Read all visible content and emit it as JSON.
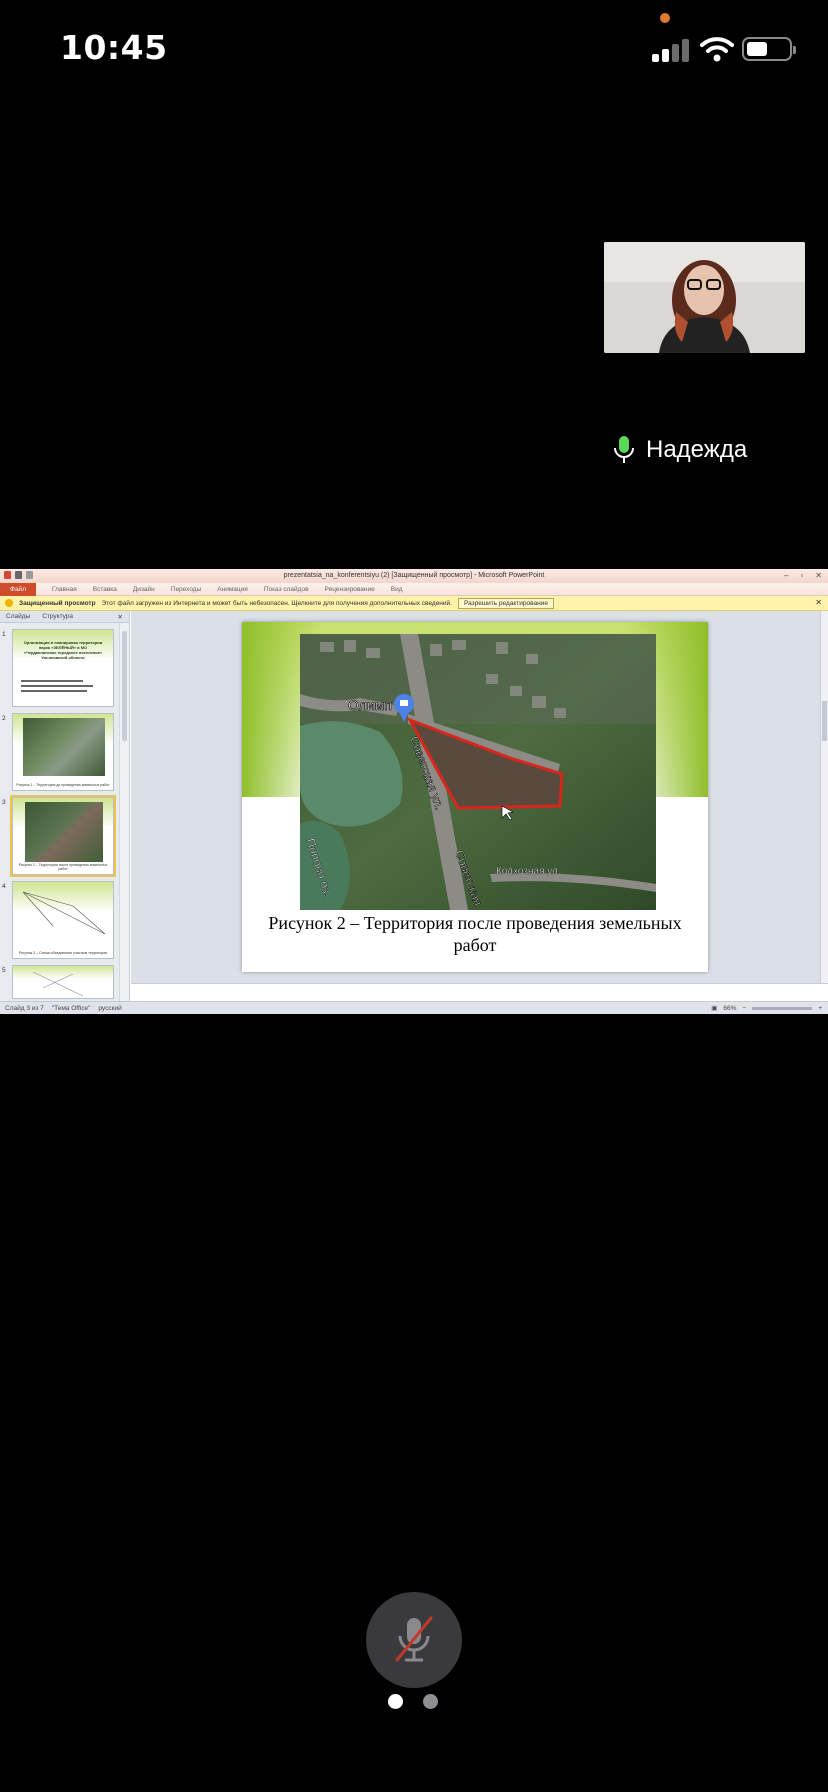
{
  "status": {
    "time": "10:45",
    "battery_level": 0.5
  },
  "participant": {
    "name": "Надежда",
    "mic": "on"
  },
  "shared_window": {
    "title": "prezentatsia_na_konferentsiyu (2) [Защищенный просмотр] - Microsoft PowerPoint",
    "ribbon_tabs": [
      "Файл",
      "Главная",
      "Вставка",
      "Дизайн",
      "Переходы",
      "Анимация",
      "Показ слайдов",
      "Рецензирование",
      "Вид"
    ],
    "info_bar": {
      "title": "Защищенный просмотр",
      "message": "Этот файл загружен из Интернета и может быть небезопасен. Щелкните для получения дополнительных сведений.",
      "button": "Разрешить редактирование"
    },
    "pane_tabs": [
      "Слайды",
      "Структура"
    ],
    "thumbnails": [
      {
        "num": "1",
        "caption": "Организация и планировка территории парка «ЗЕЛЁНЫЙ» в МО «Чердаклинское городское поселение» Ульяновской области"
      },
      {
        "num": "2",
        "caption": "Рисунок 1 – Территория до проведения земельных работ"
      },
      {
        "num": "3",
        "caption": "Рисунок 2 – Территория после проведения земельных работ"
      },
      {
        "num": "4",
        "caption": "Рисунок 3 – Схема объединения участков территории"
      },
      {
        "num": "5",
        "caption": ""
      }
    ],
    "selected_slide": 3,
    "slide": {
      "caption": "Рисунок 2 – Территория после проведения земельных работ",
      "map_labels": {
        "place": "Олимп",
        "street1": "Советская ул.",
        "street2": "Советская",
        "street3": "Колхозная ул.",
        "area": "Попово оз."
      }
    },
    "status_bar": {
      "slide": "Слайд 3 из 7",
      "theme": "\"Тема Office\"",
      "language": "русский",
      "zoom": "66%"
    }
  },
  "controls": {
    "mic_muted": true,
    "page_count": 2,
    "current_page": 1
  },
  "colors": {
    "background": "#000000",
    "mic_button": "#3a3a3c",
    "muted_slash": "#c0392b",
    "selection": "#f0c34a",
    "outline_area": "#d9261c"
  }
}
